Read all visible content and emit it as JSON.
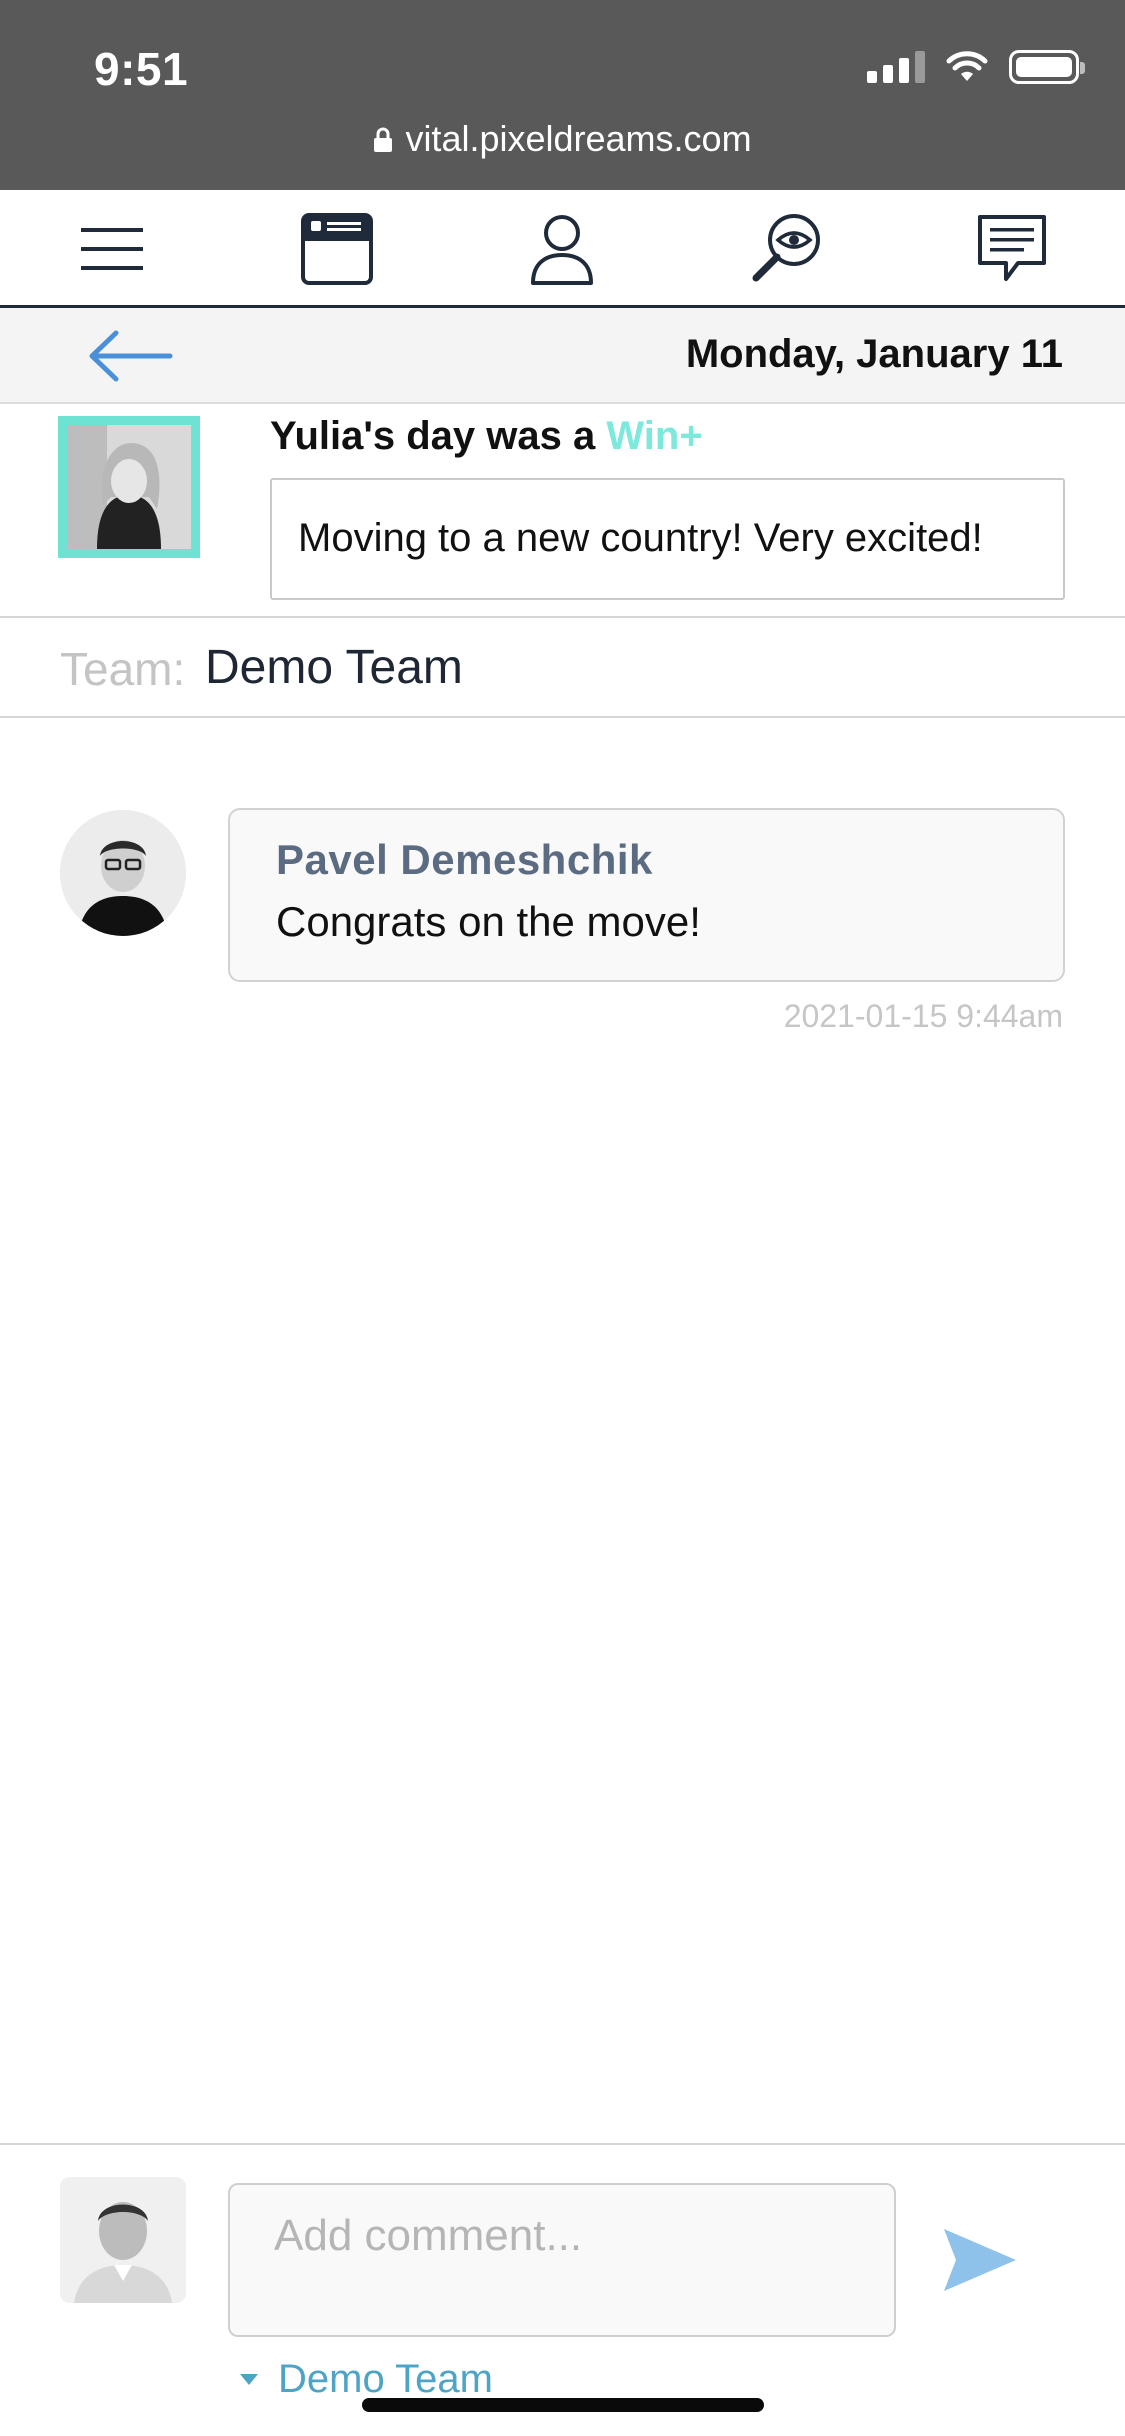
{
  "status_bar": {
    "time": "9:51",
    "url": "vital.pixeldreams.com"
  },
  "nav": {
    "icons": [
      "menu-icon",
      "calendar-card-icon",
      "profile-icon",
      "search-eye-icon",
      "chat-icon"
    ],
    "color": "#1f2a3a"
  },
  "date_bar": {
    "date": "Monday, January 11"
  },
  "entry": {
    "title_prefix": "Yulia's day was a ",
    "rating": "Win+",
    "note": "Moving to a new country! Very excited!",
    "rating_color": "#7ce9dc"
  },
  "team": {
    "label": "Team:",
    "name": "Demo Team"
  },
  "comments": [
    {
      "author": "Pavel Demeshchik",
      "text": "Congrats on the move!",
      "timestamp": "2021-01-15 9:44am"
    }
  ],
  "composer": {
    "placeholder": "Add comment...",
    "team_option": "Demo Team",
    "send_color": "#8fc2ea"
  }
}
